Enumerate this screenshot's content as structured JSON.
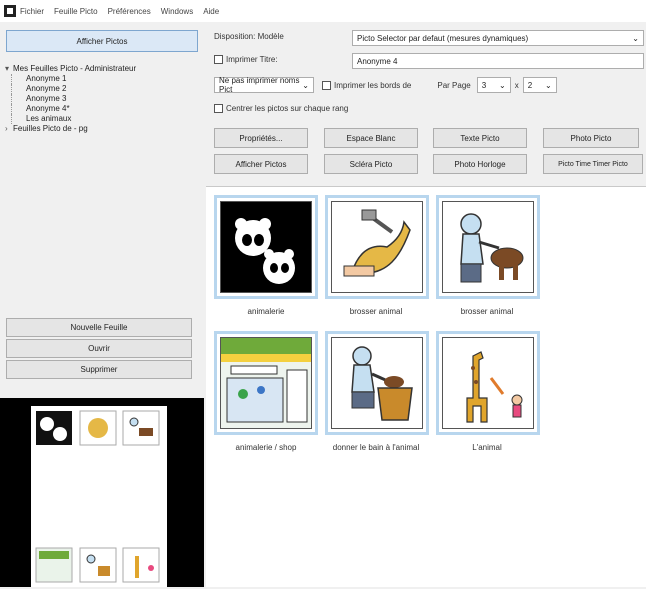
{
  "menu": [
    "Fichier",
    "Feuille Picto",
    "Préférences",
    "Windows",
    "Aide"
  ],
  "left": {
    "afficher_top": "Afficher Pictos",
    "tree": {
      "root1": "Mes Feuilles Picto - Administrateur",
      "children": [
        "Anonyme 1",
        "Anonyme 2",
        "Anonyme 3",
        "Anonyme 4*",
        "Les animaux"
      ],
      "root2": "Feuilles Picto de - pg"
    },
    "btn_new": "Nouvelle Feuille",
    "btn_open": "Ouvrir",
    "btn_delete": "Supprimer"
  },
  "form": {
    "disposition_label": "Disposition: Modèle",
    "disposition_value": "Picto Selector par defaut (mesures dynamiques)",
    "print_title_label": "Imprimer Titre:",
    "title_value": "Anonyme 4",
    "no_print_names": "Ne pas imprimer noms Pict",
    "print_borders": "Imprimer les bords de",
    "per_page": "Par Page",
    "cols": "3",
    "times": "x",
    "rows": "2",
    "center_label": "Centrer les pictos sur chaque rang"
  },
  "buttons": {
    "row1": [
      "Propriétés...",
      "Espace Blanc",
      "Texte Picto",
      "Photo Picto"
    ],
    "row2": [
      "Afficher Pictos",
      "Scléra Picto",
      "Photo Horloge",
      "Picto Time Timer Picto"
    ]
  },
  "pictos": [
    {
      "caption": "animalerie",
      "icon": "pandas-picto"
    },
    {
      "caption": "brosser animal",
      "icon": "brush-dog-picto"
    },
    {
      "caption": "brosser animal",
      "icon": "person-dog-picto"
    },
    {
      "caption": "animalerie / shop",
      "icon": "pet-shop-picto"
    },
    {
      "caption": "donner le bain à l'animal",
      "icon": "bath-dog-picto"
    },
    {
      "caption": "L'animal",
      "icon": "giraffe-picto"
    }
  ],
  "colors": {
    "tile_border": "#b8d6ee",
    "button_blue": "#dbe8f6"
  }
}
